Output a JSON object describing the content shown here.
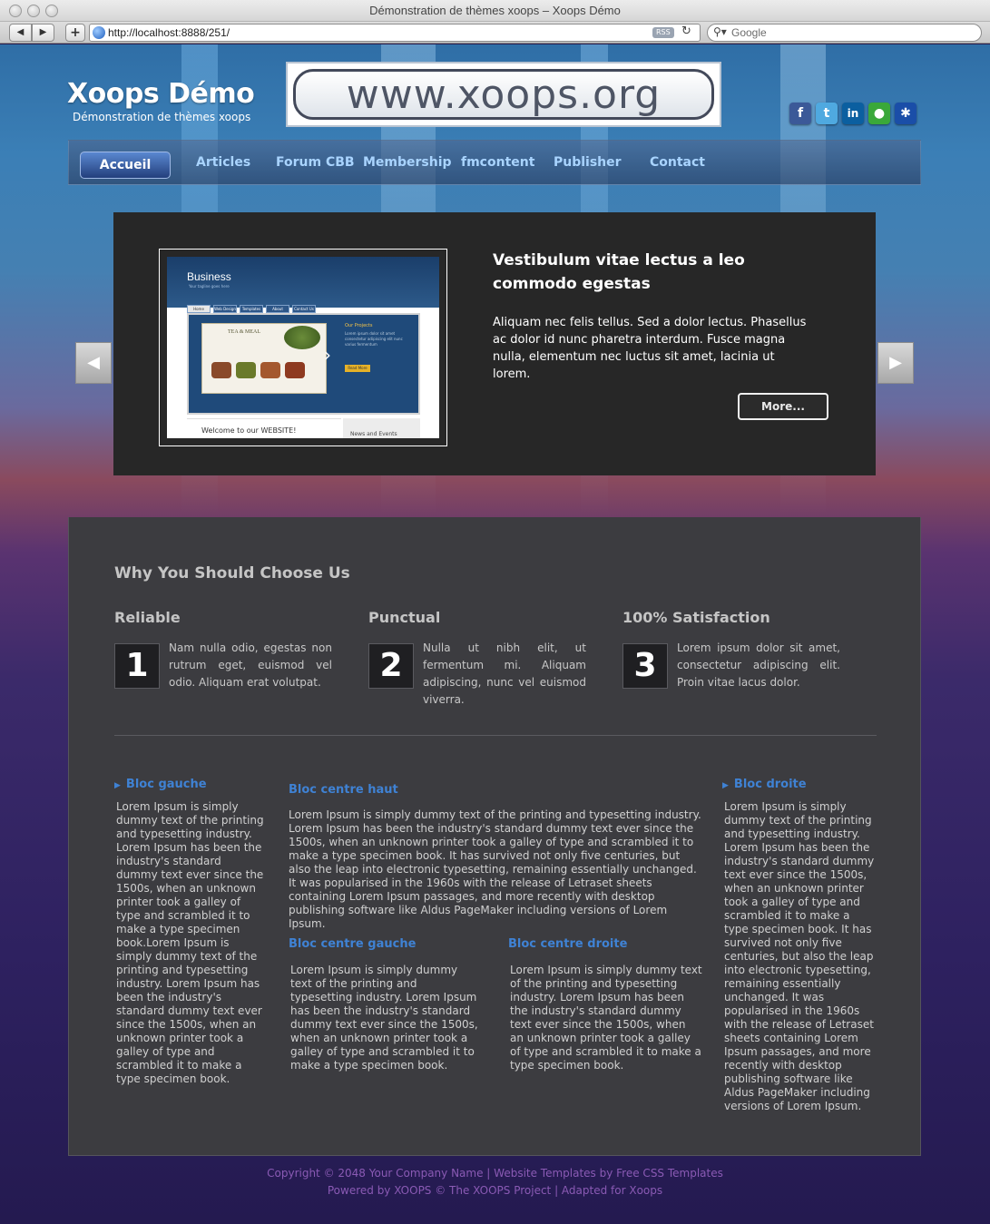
{
  "browser": {
    "window_title": "Démonstration de thèmes xoops – Xoops Démo",
    "back": "◀",
    "forward": "▶",
    "add": "+",
    "url": "http://localhost:8888/251/",
    "rss": "RSS",
    "reload": "↻",
    "search_placeholder": "Google",
    "search_icon": "magnifier-icon"
  },
  "header": {
    "site_name": "Xoops Démo",
    "slogan": "Démonstration de thèmes xoops",
    "logo_text": "www.xoops.org",
    "social": [
      {
        "name": "facebook",
        "glyph": "f",
        "color": "#3b5998"
      },
      {
        "name": "twitter",
        "glyph": "t",
        "color": "#4fa9e0"
      },
      {
        "name": "linkedin",
        "glyph": "in",
        "color": "#0b5fa0"
      },
      {
        "name": "talk",
        "glyph": "●",
        "color": "#3aa83a"
      },
      {
        "name": "myspace",
        "glyph": "✱",
        "color": "#1a4ea8"
      }
    ]
  },
  "nav": {
    "items": [
      "Accueil",
      "Articles",
      "Forum CBB",
      "Membership",
      "fmcontent",
      "Publisher",
      "Contact"
    ],
    "active": "Accueil"
  },
  "slider": {
    "title": "Vestibulum vitae lectus a leo commodo egestas",
    "text": "Aliquam nec felis tellus. Sed a dolor lectus. Phasellus ac dolor id nunc pharetra interdum. Fusce magna nulla, elementum nec luctus sit amet, lacinia ut lorem.",
    "more": "More...",
    "prev": "◀",
    "next": "▶",
    "shot": {
      "title": "Business",
      "subtitle": "Your tagline goes here",
      "tabs": [
        "Home",
        "Web Design",
        "Templates",
        "About",
        "Contact Us"
      ],
      "inner_title": "TEA & MEAL",
      "projects": "Our Projects",
      "projects_text": "Lorem ipsum dolor sit amet consectetur adipiscing elit nunc varius fermentum",
      "read_more": "Read More",
      "welcome": "Welcome to our WEBSITE!",
      "news": "News and Events"
    }
  },
  "why": {
    "title": "Why You Should Choose Us",
    "features": [
      {
        "num": "1",
        "title": "Reliable",
        "text": "Nam nulla odio, egestas non rutrum eget, euismod vel odio. Aliquam erat volutpat."
      },
      {
        "num": "2",
        "title": "Punctual",
        "text": "Nulla ut nibh elit, ut fermentum mi. Aliquam adipiscing, nunc vel euismod viverra."
      },
      {
        "num": "3",
        "title": "100% Satisfaction",
        "text": "Lorem ipsum dolor sit amet, consectetur adipiscing elit. Proin vitae lacus dolor."
      }
    ]
  },
  "blocks": {
    "left": {
      "title": "Bloc gauche",
      "text": "Lorem Ipsum is simply dummy text of the printing and typesetting industry. Lorem Ipsum has been the industry's standard dummy text ever since the 1500s, when an unknown printer took a galley of type and scrambled it to make a type specimen book.Lorem Ipsum is simply dummy text of the printing and typesetting industry. Lorem Ipsum has been the industry's standard dummy text ever since the 1500s, when an unknown printer took a galley of type and scrambled it to make a type specimen book."
    },
    "center_top": {
      "title": "Bloc centre haut",
      "text": "Lorem Ipsum is simply dummy text of the printing and typesetting industry. Lorem Ipsum has been the industry's standard dummy text ever since the 1500s, when an unknown printer took a galley of type and scrambled it to make a type specimen book. It has survived not only five centuries, but also the leap into electronic typesetting, remaining essentially unchanged. It was popularised in the 1960s with the release of Letraset sheets containing Lorem Ipsum passages, and more recently with desktop publishing software like Aldus PageMaker including versions of Lorem Ipsum."
    },
    "center_left": {
      "title": "Bloc centre gauche",
      "text": "Lorem Ipsum is simply dummy text of the printing and typesetting industry. Lorem Ipsum has been the industry's standard dummy text ever since the 1500s, when an unknown printer took a galley of type and scrambled it to make a type specimen book."
    },
    "center_right": {
      "title": "Bloc centre droite",
      "text": "Lorem Ipsum is simply dummy text of the printing and typesetting industry. Lorem Ipsum has been the industry's standard dummy text ever since the 1500s, when an unknown printer took a galley of type and scrambled it to make a type specimen book."
    },
    "right": {
      "title": "Bloc droite",
      "text": "Lorem Ipsum is simply dummy text of the printing and typesetting industry. Lorem Ipsum has been the industry's standard dummy text ever since the 1500s, when an unknown printer took a galley of type and scrambled it to make a type specimen book. It has survived not only five centuries, but also the leap into electronic typesetting, remaining essentially unchanged. It was popularised in the 1960s with the release of Letraset sheets containing Lorem Ipsum passages, and more recently with desktop publishing software like Aldus PageMaker including versions of Lorem Ipsum."
    }
  },
  "footer": {
    "line1": "Copyright © 2048 Your Company Name | Website Templates by Free CSS Templates",
    "line2": "Powered by XOOPS © The XOOPS Project | Adapted for Xoops"
  }
}
